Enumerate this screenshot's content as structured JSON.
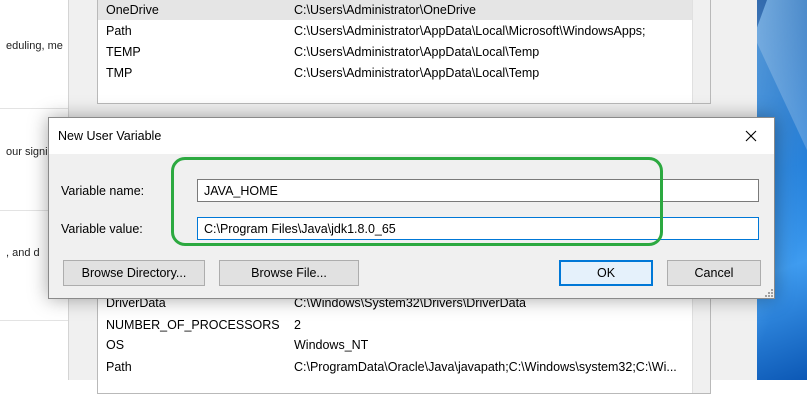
{
  "settings": {
    "snippets": [
      "eduling, me",
      "our signi",
      ", and d"
    ]
  },
  "user_variables": [
    {
      "name": "OneDrive",
      "value": "C:\\Users\\Administrator\\OneDrive"
    },
    {
      "name": "Path",
      "value": "C:\\Users\\Administrator\\AppData\\Local\\Microsoft\\WindowsApps;"
    },
    {
      "name": "TEMP",
      "value": "C:\\Users\\Administrator\\AppData\\Local\\Temp"
    },
    {
      "name": "TMP",
      "value": "C:\\Users\\Administrator\\AppData\\Local\\Temp"
    }
  ],
  "system_variables": [
    {
      "name": "DriverData",
      "value": "C:\\Windows\\System32\\Drivers\\DriverData"
    },
    {
      "name": "NUMBER_OF_PROCESSORS",
      "value": "2"
    },
    {
      "name": "OS",
      "value": "Windows_NT"
    },
    {
      "name": "Path",
      "value": "C:\\ProgramData\\Oracle\\Java\\javapath;C:\\Windows\\system32;C:\\Wi..."
    }
  ],
  "dialog": {
    "title": "New User Variable",
    "name_label": "Variable name:",
    "name_value": "JAVA_HOME",
    "value_label": "Variable value:",
    "value_value": "C:\\Program Files\\Java\\jdk1.8.0_65",
    "browse_directory_label": "Browse Directory...",
    "browse_file_label": "Browse File...",
    "ok_label": "OK",
    "cancel_label": "Cancel"
  },
  "colors": {
    "highlight": "#2ca940",
    "focus": "#0078d7"
  }
}
